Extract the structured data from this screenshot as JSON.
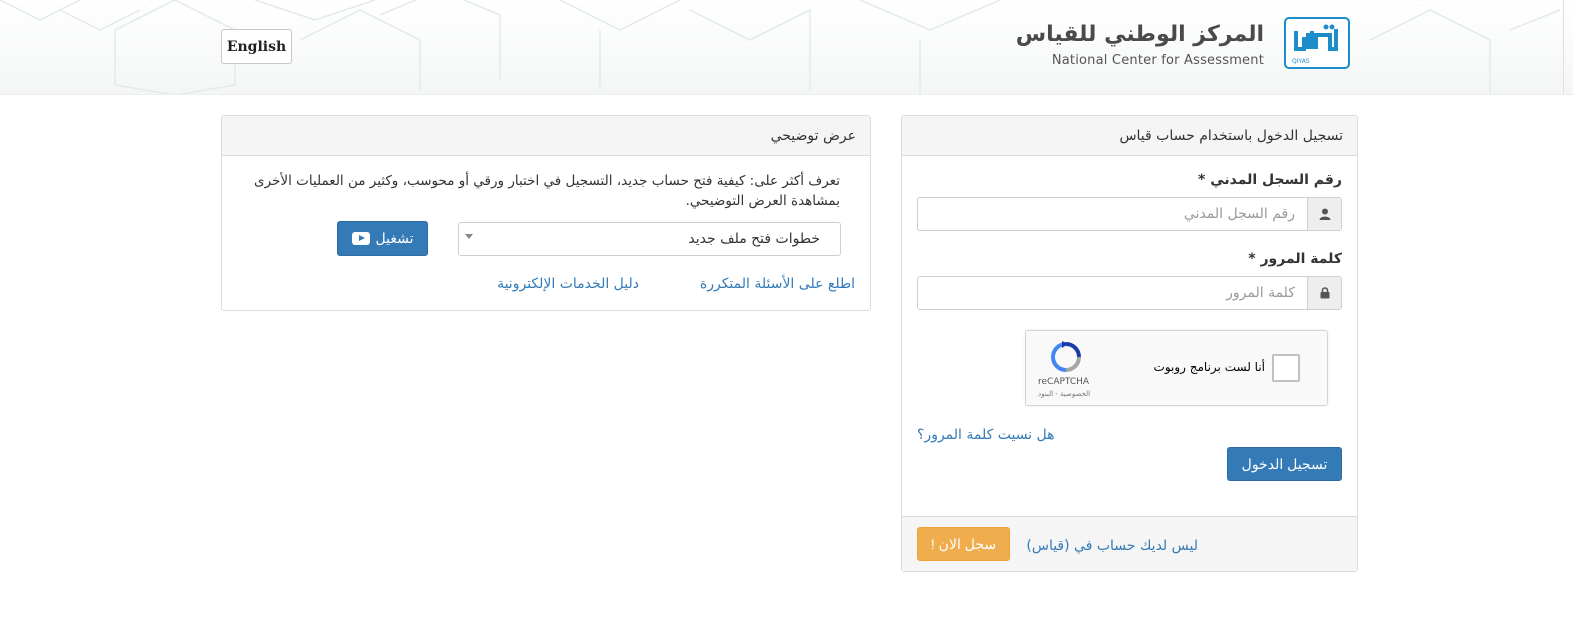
{
  "header": {
    "language_button": "English",
    "logo_title_ar": "المركز الوطني للقياس",
    "logo_title_en": "National Center for Assessment",
    "logo_mark_text": "QIYAS"
  },
  "demo_panel": {
    "title": "عرض توضيحي",
    "description": "تعرف أكثر على: كيفية فتح حساب جديد، التسجيل في اختبار ورقي أو محوسب، وكثير من العمليات الأخرى بمشاهدة العرض التوضيحي.",
    "select_value": "خطوات فتح ملف جديد",
    "play_button": "تشغيل",
    "faq_link": "اطلع على الأسئلة المتكررة",
    "guide_link": "دليل الخدمات الإلكترونية"
  },
  "login_panel": {
    "title": "تسجيل الدخول باستخدام حساب قياس",
    "national_id_label": "رقم السجل المدني *",
    "national_id_placeholder": "رقم السجل المدني",
    "national_id_value": "",
    "password_label": "كلمة المرور *",
    "password_placeholder": "كلمة المرور",
    "password_value": "",
    "captcha_text": "أنا لست برنامج روبوت",
    "captcha_brand": "reCAPTCHA",
    "captcha_terms": "الخصوصية - البنود",
    "forgot_password": "هل نسيت كلمة المرور؟",
    "login_button": "تسجيل الدخول",
    "no_account_text": "ليس لديك حساب في (قياس)",
    "register_button": "سجل الان !"
  },
  "colors": {
    "primary": "#337ab7",
    "warning": "#f0ad4e",
    "logo_blue": "#1d8dc9"
  }
}
